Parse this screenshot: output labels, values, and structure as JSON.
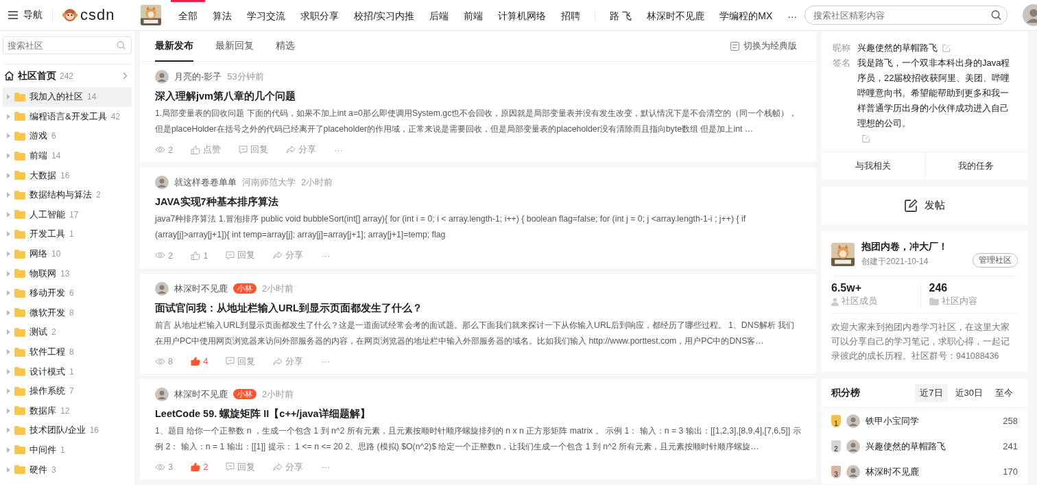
{
  "topbar": {
    "menu_label": "导航",
    "logo": "csdn",
    "nav": [
      {
        "label": "全部",
        "selected": true
      },
      {
        "label": "算法",
        "selected": false
      },
      {
        "label": "学习交流",
        "selected": false
      },
      {
        "label": "求职分享",
        "selected": false
      },
      {
        "label": "校招/实习内推",
        "selected": false
      },
      {
        "label": "后端",
        "selected": false
      },
      {
        "label": "前端",
        "selected": false
      },
      {
        "label": "计算机网络",
        "selected": false
      },
      {
        "label": "招聘",
        "selected": false
      }
    ],
    "users": [
      "路 飞",
      "林深时不见鹿",
      "学编程的MX"
    ],
    "more": "···",
    "search": {
      "placeholder": "搜索社区精彩内容"
    }
  },
  "sidebar": {
    "search": {
      "placeholder": "搜索社区"
    },
    "home": {
      "label": "社区首页",
      "count": "242"
    },
    "items": [
      {
        "name": "我加入的社区",
        "count": "14",
        "selected": true
      },
      {
        "name": "编程语言&开发工具",
        "count": "42",
        "selected": false
      },
      {
        "name": "游戏",
        "count": "6",
        "selected": false
      },
      {
        "name": "前端",
        "count": "14",
        "selected": false
      },
      {
        "name": "大数据",
        "count": "16",
        "selected": false
      },
      {
        "name": "数据结构与算法",
        "count": "2",
        "selected": false
      },
      {
        "name": "人工智能",
        "count": "17",
        "selected": false
      },
      {
        "name": "开发工具",
        "count": "1",
        "selected": false
      },
      {
        "name": "网络",
        "count": "10",
        "selected": false
      },
      {
        "name": "物联网",
        "count": "13",
        "selected": false
      },
      {
        "name": "移动开发",
        "count": "6",
        "selected": false
      },
      {
        "name": "微软开发",
        "count": "8",
        "selected": false
      },
      {
        "name": "测试",
        "count": "2",
        "selected": false
      },
      {
        "name": "软件工程",
        "count": "8",
        "selected": false
      },
      {
        "name": "设计模式",
        "count": "1",
        "selected": false
      },
      {
        "name": "操作系统",
        "count": "7",
        "selected": false
      },
      {
        "name": "数据库",
        "count": "12",
        "selected": false
      },
      {
        "name": "技术团队/企业",
        "count": "16",
        "selected": false
      },
      {
        "name": "中间件",
        "count": "1",
        "selected": false
      },
      {
        "name": "硬件",
        "count": "3",
        "selected": false
      }
    ]
  },
  "feed": {
    "tabs": [
      {
        "label": "最新发布",
        "selected": true
      },
      {
        "label": "最新回复",
        "selected": false
      },
      {
        "label": "精选",
        "selected": false
      }
    ],
    "switch_label": "切换为经典版",
    "posts": [
      {
        "author": "月亮的-影子",
        "time": "53分钟前",
        "title": "深入理解jvm第八章的几个问题",
        "excerpt": "1.局部变量表的回收问题 下面的代码，如果不加上int a=0那么即使调用System.gc也不会回收，原因就是局部变量表并没有发生改变，默认情况下是不会清空的（同一个栈帧），但是placeHolder在括号之外的代码已经离开了placeholder的作用域，正常来说是需要回收，但是局部变量表的placeholder没有清除而且指向byte数组 但是加上int …",
        "views": "2",
        "likes": "点赞",
        "liked": false,
        "reply": "回复",
        "share": "分享",
        "more": "···"
      },
      {
        "author": "就这样卷卷单单",
        "school": "河南师范大学",
        "time": "2小时前",
        "title": "JAVA实现7种基本排序算法",
        "excerpt": "java7种排序算法 1.冒泡排序 public void bubbleSort(int[] array){ for (int i = 0; i < array.length-1; i++) { boolean flag=false; for (int j = 0; j <array.length-1-i ; j++) { if (array[j]>array[j+1]){ int temp=array[j]; array[j]=array[j+1]; array[j+1]=temp; flag",
        "views": "2",
        "likes": "1",
        "liked": false,
        "reply": "回复",
        "share": "分享",
        "more": "···"
      },
      {
        "author": "林深时不见鹿",
        "badge": "小林",
        "time": "2小时前",
        "title": "面试官问我：从地址栏输入URL到显示页面都发生了什么？",
        "excerpt": "前言 从地址栏输入URL到显示页面都发生了什么？这是一道面试经常会考的面试题。那么下面我们就来探讨一下从你输入URL后到响应，都经历了哪些过程。 1、DNS解析 我们在用户PC中使用网页浏览器来访问外部服务器的内容，在网页浏览器的地址栏中输入外部服务器的域名。比如我们输入 http://www.porttest.com，用户PC中的DNS客…",
        "views": "8",
        "likes": "4",
        "liked": true,
        "reply": "回复",
        "share": "分享",
        "more": "···"
      },
      {
        "author": "林深时不见鹿",
        "badge": "小林",
        "time": "2小时前",
        "title": "LeetCode 59. 螺旋矩阵 II【c++/java详细题解】",
        "excerpt": "1、题目 给你一个正整数 n ，生成一个包含 1 到 n^2 所有元素，且元素按顺时针顺序螺旋排列的 n x n 正方形矩阵 matrix 。 示例 1： 输入：n = 3 输出：[[1,2,3],[8,9,4],[7,6,5]] 示例 2： 输入：n = 1 输出：[[1]] 提示： 1 <= n <= 20 2、思路 (模拟) $O(n^2)$ 给定一个正整数n，让我们生成一个包含 1 到 n^2 所有元素，且元素按顺时针顺序螺旋…",
        "views": "3",
        "likes": "2",
        "liked": true,
        "reply": "回复",
        "share": "分享",
        "more": "···"
      }
    ]
  },
  "profile": {
    "nickname_label": "昵称",
    "nickname": "兴趣使然的草帽路飞",
    "signature_label": "签名",
    "signature": "我是路飞，一个双非本科出身的Java程序员，22届校招收获阿里、美团、哔哩哔哩意向书。希望能帮助到更多和我一样普通学历出身的小伙伴成功进入自己理想的公司。",
    "links": [
      "与我相关",
      "我的任务"
    ]
  },
  "post_button": "发帖",
  "community": {
    "name": "抱团内卷，冲大厂！",
    "created": "创建于2021-10-14",
    "manage": "管理社区",
    "members": "6.5w+",
    "members_label": "社区成员",
    "contents": "246",
    "contents_label": "社区内容",
    "description": "欢迎大家来到抱团内卷学习社区，在这里大家可以分享自己的学习笔记，求职心得，一起记录彼此的成长历程。社区群号：941088436"
  },
  "ranking": {
    "title": "积分榜",
    "tabs": [
      {
        "label": "近7日",
        "selected": true
      },
      {
        "label": "近30日",
        "selected": false
      },
      {
        "label": "至今",
        "selected": false
      }
    ],
    "rows": [
      {
        "rank": "1",
        "name": "铁甲小宝同学",
        "score": "258",
        "color": "#f3c04b"
      },
      {
        "rank": "2",
        "name": "兴趣使然的草帽路飞",
        "score": "241",
        "color": "#d3d5d9"
      },
      {
        "rank": "3",
        "name": "林深时不见鹿",
        "score": "170",
        "color": "#d9b4a4"
      }
    ]
  }
}
